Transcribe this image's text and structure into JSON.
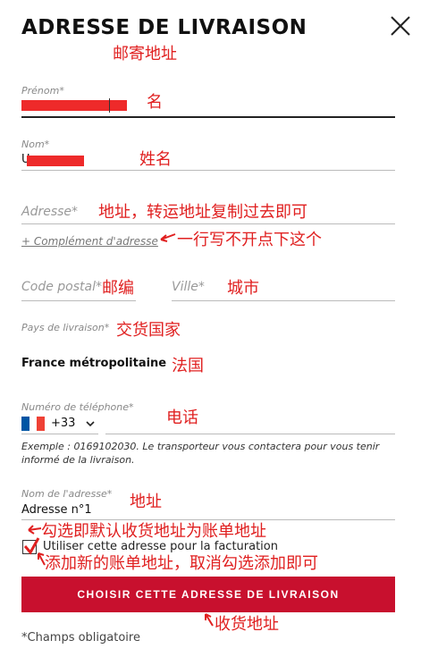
{
  "header": {
    "title": "ADRESSE DE LIVRAISON",
    "close_icon": "close-icon"
  },
  "notes": {
    "postal_address": "邮寄地址",
    "first_name": "名",
    "last_name": "姓名",
    "address": "地址，转运地址复制过去即可",
    "complement": "一行写不开点下这个",
    "postal_code": "邮编",
    "city": "城市",
    "delivery_country": "交货国家",
    "france": "法国",
    "phone": "电话",
    "address_name": "地址",
    "billing_default": "勾选即默认收货地址为账单地址",
    "billing_new": "添加新的账单地址，取消勾选添加即可",
    "shipping_address": "收货地址"
  },
  "form": {
    "first_name_label": "Prénom*",
    "last_name_label": "Nom*",
    "last_name_value_prefix": "U",
    "address_placeholder": "Adresse*",
    "complement_link": "+ Complément d'adresse",
    "postal_placeholder": "Code postal*",
    "city_placeholder": "Ville*",
    "country_label": "Pays de livraison*",
    "country_value": "France métropolitaine",
    "phone_label": "Numéro de téléphone*",
    "phone_code": "+33",
    "phone_help": "Exemple : 0169102030. Le transporteur vous contactera pour vous tenir informé de la livraison.",
    "address_name_label": "Nom de l'adresse*",
    "address_name_value": "Adresse n°1",
    "billing_checkbox_label": "Utiliser cette adresse pour la facturation",
    "billing_checked": true,
    "submit_label": "CHOISIR CETTE ADRESSE DE LIVRAISON",
    "required_note": "*Champs obligatoire"
  },
  "colors": {
    "accent": "#c8102e",
    "annotation": "#e02020",
    "redaction": "#ee2a2a"
  }
}
